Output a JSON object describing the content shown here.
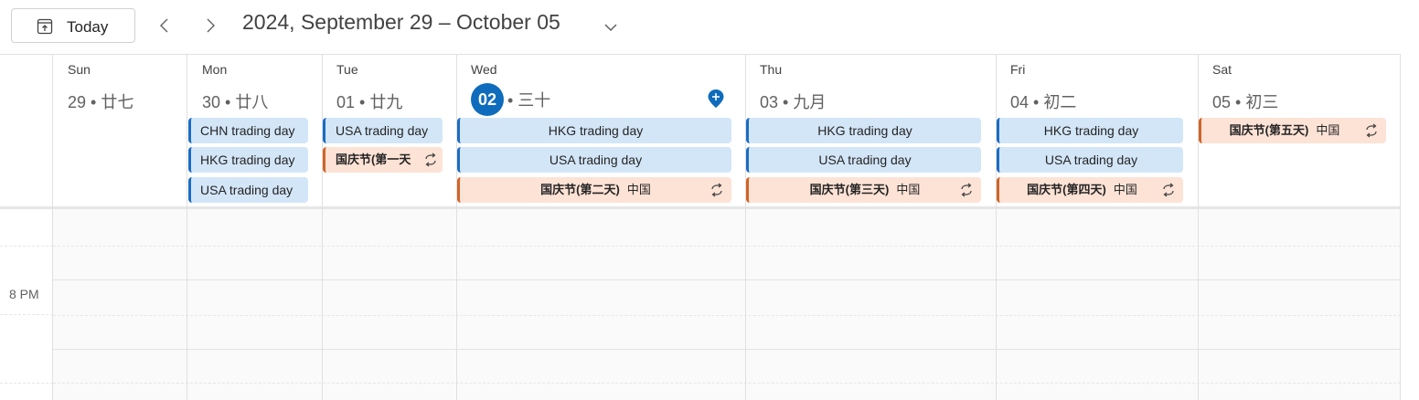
{
  "toolbar": {
    "today_label": "Today",
    "range_title": "2024, September 29 – October 05"
  },
  "time_labels": [
    "8 PM"
  ],
  "days": [
    {
      "name": "Sun",
      "date": "29 • 廿七"
    },
    {
      "name": "Mon",
      "date": "30 • 廿八"
    },
    {
      "name": "Tue",
      "date": "01 • 廿九"
    },
    {
      "name": "Wed",
      "date_num": "02",
      "date_rest": "• 三十",
      "is_today": true
    },
    {
      "name": "Thu",
      "date": "03 • 九月"
    },
    {
      "name": "Fri",
      "date": "04 • 初二"
    },
    {
      "name": "Sat",
      "date": "05 • 初三"
    }
  ],
  "events": {
    "mon": [
      "CHN trading day",
      "HKG trading day",
      "USA trading day"
    ],
    "tue": [
      "USA trading day",
      "国庆节(第一天"
    ],
    "wed": [
      "HKG trading day",
      "USA trading day",
      {
        "title": "国庆节(第二天)",
        "location": "中国"
      }
    ],
    "thu": [
      "HKG trading day",
      "USA trading day",
      {
        "title": "国庆节(第三天)",
        "location": "中国"
      }
    ],
    "fri": [
      "HKG trading day",
      "USA trading day",
      {
        "title": "国庆节(第四天)",
        "location": "中国"
      }
    ],
    "sat": [
      {
        "title": "国庆节(第五天)",
        "location": "中国"
      }
    ]
  },
  "colors": {
    "accent": "#0f6cbd",
    "event_blue_bg": "#d3e6f8",
    "event_blue_bar": "#1b6cc4",
    "event_orange_bg": "#fde3d6",
    "event_orange_bar": "#d06428"
  }
}
